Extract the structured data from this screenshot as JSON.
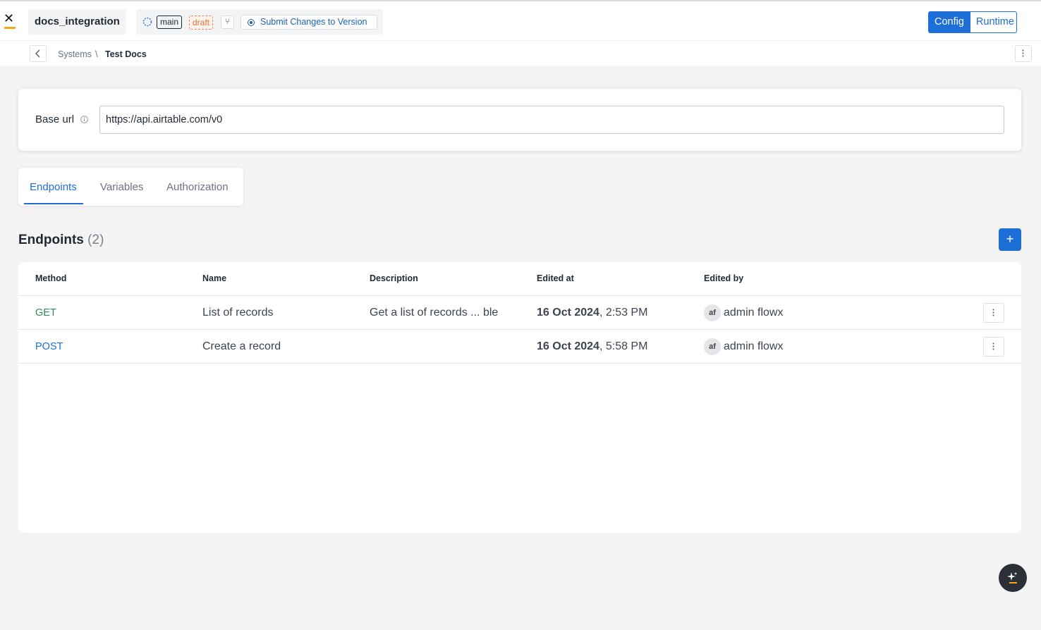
{
  "header": {
    "project_name": "docs_integration",
    "branch": "main",
    "status": "draft",
    "submit_label": "Submit Changes to Version",
    "mode_config": "Config",
    "mode_runtime": "Runtime"
  },
  "breadcrumb": {
    "parent": "Systems",
    "separator": "\\",
    "current": "Test Docs"
  },
  "base_url": {
    "label": "Base url",
    "value": "https://api.airtable.com/v0"
  },
  "tabs": [
    {
      "label": "Endpoints",
      "active": true
    },
    {
      "label": "Variables",
      "active": false
    },
    {
      "label": "Authorization",
      "active": false
    }
  ],
  "endpoints": {
    "title": "Endpoints",
    "count": "(2)",
    "add_label": "+",
    "columns": [
      "Method",
      "Name",
      "Description",
      "Edited at",
      "Edited by"
    ],
    "rows": [
      {
        "method": "GET",
        "name": "List of records",
        "description": "Get a list of records ... ble",
        "edited_date": "16 Oct 2024",
        "edited_time": ", 2:53 PM",
        "editor_initials": "af",
        "editor_name": "admin flowx"
      },
      {
        "method": "POST",
        "name": "Create a record",
        "description": "",
        "edited_date": "16 Oct 2024",
        "edited_time": ", 5:58 PM",
        "editor_initials": "af",
        "editor_name": "admin flowx"
      }
    ]
  },
  "colors": {
    "accent": "#1d6ed6",
    "get_method": "#2f8a5a",
    "draft_tag": "#e0703f",
    "logo_accent": "#f2a81d"
  },
  "icons": [
    "logo-icon",
    "sync-icon",
    "branch-icon",
    "radio-icon",
    "chevron-left-icon",
    "more-vertical-icon",
    "info-icon",
    "plus-icon",
    "ai-sparkle-icon"
  ]
}
